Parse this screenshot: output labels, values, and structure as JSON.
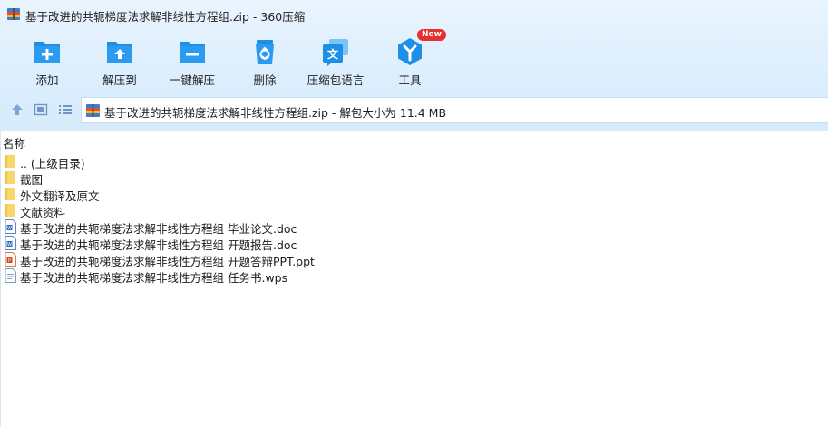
{
  "window": {
    "title": "基于改进的共轭梯度法求解非线性方程组.zip - 360压缩"
  },
  "toolbar": {
    "items": [
      {
        "label": "添加",
        "icon": "add-folder-icon"
      },
      {
        "label": "解压到",
        "icon": "extract-to-icon"
      },
      {
        "label": "一键解压",
        "icon": "one-click-extract-icon"
      },
      {
        "label": "删除",
        "icon": "recycle-bin-icon"
      },
      {
        "label": "压缩包语言",
        "icon": "language-icon"
      },
      {
        "label": "工具",
        "icon": "tools-icon",
        "badge": "New"
      }
    ]
  },
  "address": {
    "path": "基于改进的共轭梯度法求解非线性方程组.zip - 解包大小为 11.4 MB"
  },
  "filelist": {
    "column_name": "名称",
    "rows": [
      {
        "name": ".. (上级目录)",
        "type": "folder"
      },
      {
        "name": "截图",
        "type": "folder"
      },
      {
        "name": "外文翻译及原文",
        "type": "folder"
      },
      {
        "name": "文献资料",
        "type": "folder"
      },
      {
        "name": "基于改进的共轭梯度法求解非线性方程组 毕业论文.doc",
        "type": "doc"
      },
      {
        "name": "基于改进的共轭梯度法求解非线性方程组 开题报告.doc",
        "type": "doc"
      },
      {
        "name": "基于改进的共轭梯度法求解非线性方程组 开题答辩PPT.ppt",
        "type": "ppt"
      },
      {
        "name": "基于改进的共轭梯度法求解非线性方程组 任务书.wps",
        "type": "wps"
      }
    ]
  },
  "colors": {
    "toolbar_bg": "#dceefd",
    "icon_blue": "#1e8fe6",
    "folder_yellow": "#f7d66b",
    "badge_red": "#e8302f"
  }
}
